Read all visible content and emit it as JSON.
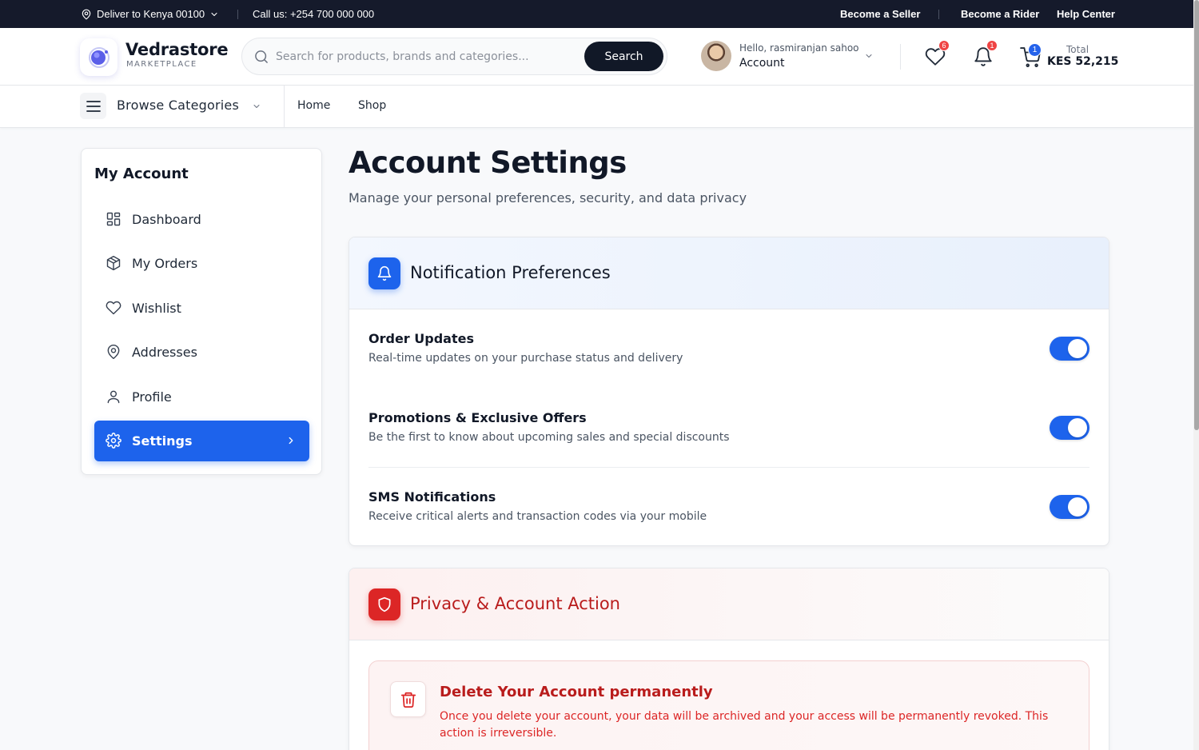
{
  "topbar": {
    "deliver": "Deliver to Kenya 00100",
    "call": "Call us: +254 700 000 000",
    "become_seller": "Become a Seller",
    "become_rider": "Become a Rider",
    "help_center": "Help Center"
  },
  "header": {
    "brand_name": "Vedrastore",
    "brand_sub": "MARKETPLACE",
    "search_placeholder": "Search for products, brands and categories...",
    "search_value": "",
    "search_button": "Search",
    "account_hello": "Hello, rasmiranjan sahoo",
    "account_label": "Account",
    "wishlist_count": "6",
    "notification_count": "1",
    "cart_count": "1",
    "cart_total_label": "Total",
    "cart_total": "KES 52,215"
  },
  "nav": {
    "browse": "Browse Categories",
    "links": [
      "Home",
      "Shop"
    ]
  },
  "sidebar": {
    "title": "My Account",
    "items": [
      {
        "label": "Dashboard",
        "icon": "dashboard-icon"
      },
      {
        "label": "My Orders",
        "icon": "package-icon"
      },
      {
        "label": "Wishlist",
        "icon": "heart-icon"
      },
      {
        "label": "Addresses",
        "icon": "map-pin-icon"
      },
      {
        "label": "Profile",
        "icon": "user-icon"
      },
      {
        "label": "Settings",
        "icon": "gear-icon",
        "active": true
      }
    ]
  },
  "main": {
    "title": "Account Settings",
    "subtitle": "Manage your personal preferences, security, and data privacy",
    "notifications": {
      "title": "Notification Preferences",
      "items": [
        {
          "title": "Order Updates",
          "desc": "Real-time updates on your purchase status and delivery",
          "enabled": true
        },
        {
          "title": "Promotions & Exclusive Offers",
          "desc": "Be the first to know about upcoming sales and special discounts",
          "enabled": true
        },
        {
          "title": "SMS Notifications",
          "desc": "Receive critical alerts and transaction codes via your mobile",
          "enabled": true
        }
      ]
    },
    "privacy": {
      "title": "Privacy & Account Action",
      "delete_title": "Delete Your Account permanently",
      "delete_desc": "Once you delete your account, your data will be archived and your access will be permanently revoked. This action is irreversible."
    }
  },
  "colors": {
    "accent": "#1d63ec",
    "danger": "#dc2626",
    "topbar": "#151a2b"
  }
}
